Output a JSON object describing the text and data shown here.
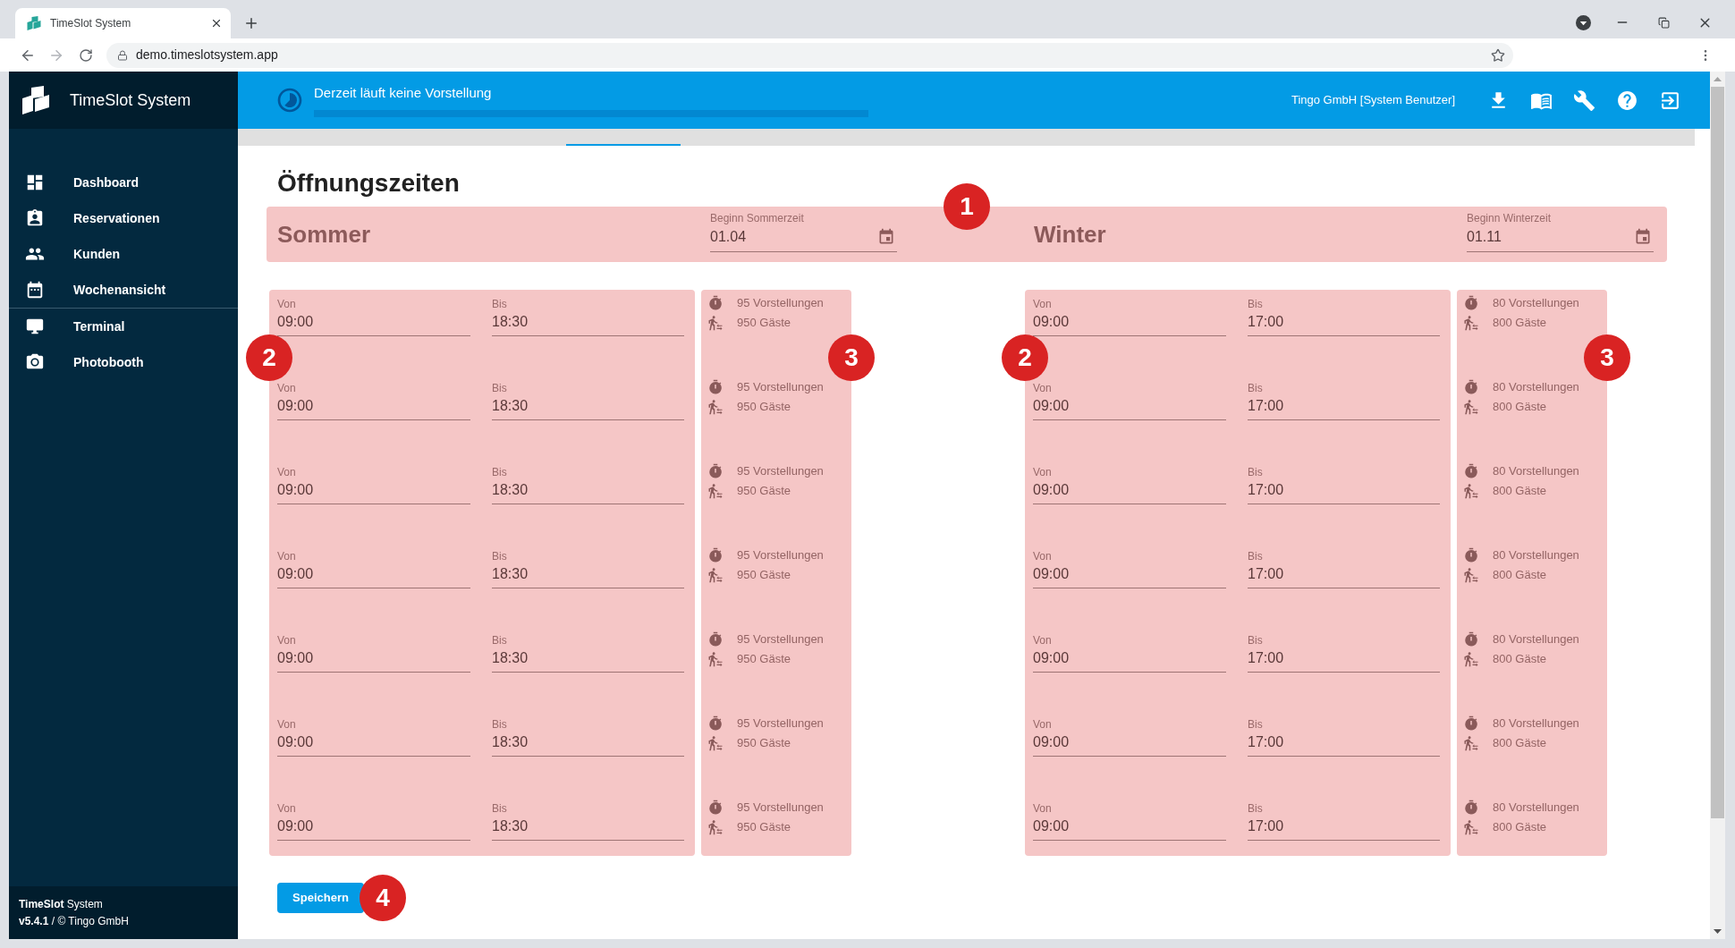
{
  "browser": {
    "tab_title": "TimeSlot System",
    "url": "demo.timeslotsystem.app"
  },
  "sidebar": {
    "brand": "TimeSlot System",
    "groups": [
      {
        "items": [
          {
            "label": "Dashboard",
            "selected": false
          },
          {
            "label": "Reservationen",
            "selected": false
          },
          {
            "label": "Kunden",
            "selected": false
          },
          {
            "label": "Wochenansicht",
            "selected": false
          }
        ]
      },
      {
        "items": [
          {
            "label": "Terminal",
            "selected": false
          },
          {
            "label": "Photobooth",
            "selected": false
          }
        ]
      }
    ],
    "footer": {
      "app": "**TimeSlot** System",
      "version": "**v5.4.1** / © Tingo GmbH"
    }
  },
  "header": {
    "status": "Derzeit läuft keine Vorstellung",
    "progress": {
      "level": 0
    },
    "user": "Tingo GmbH [System Benutzer]"
  },
  "page": {
    "title": "Öffnungszeiten",
    "seasons_marker": "1",
    "seasons": [
      {
        "name": "Sommer",
        "start": {
          "label": "Beginn Sommerzeit",
          "value": "01.04"
        },
        "hours_marker": "2",
        "stats_marker": "3",
        "days": [
          {
            "from": {
              "label": "Von",
              "value": "09:00"
            },
            "to": {
              "label": "Bis",
              "value": "18:30"
            },
            "shows": "95 Vorstellungen",
            "guests": "950 Gäste"
          },
          {
            "from": {
              "label": "Von",
              "value": "09:00"
            },
            "to": {
              "label": "Bis",
              "value": "18:30"
            },
            "shows": "95 Vorstellungen",
            "guests": "950 Gäste"
          },
          {
            "from": {
              "label": "Von",
              "value": "09:00"
            },
            "to": {
              "label": "Bis",
              "value": "18:30"
            },
            "shows": "95 Vorstellungen",
            "guests": "950 Gäste"
          },
          {
            "from": {
              "label": "Von",
              "value": "09:00"
            },
            "to": {
              "label": "Bis",
              "value": "18:30"
            },
            "shows": "95 Vorstellungen",
            "guests": "950 Gäste"
          },
          {
            "from": {
              "label": "Von",
              "value": "09:00"
            },
            "to": {
              "label": "Bis",
              "value": "18:30"
            },
            "shows": "95 Vorstellungen",
            "guests": "950 Gäste"
          },
          {
            "from": {
              "label": "Von",
              "value": "09:00"
            },
            "to": {
              "label": "Bis",
              "value": "18:30"
            },
            "shows": "95 Vorstellungen",
            "guests": "950 Gäste"
          },
          {
            "from": {
              "label": "Von",
              "value": "09:00"
            },
            "to": {
              "label": "Bis",
              "value": "18:30"
            },
            "shows": "95 Vorstellungen",
            "guests": "950 Gäste"
          }
        ]
      },
      {
        "name": "Winter",
        "start": {
          "label": "Beginn Winterzeit",
          "value": "01.11"
        },
        "hours_marker": "2",
        "stats_marker": "3",
        "days": [
          {
            "from": {
              "label": "Von",
              "value": "09:00"
            },
            "to": {
              "label": "Bis",
              "value": "17:00"
            },
            "shows": "80 Vorstellungen",
            "guests": "800 Gäste"
          },
          {
            "from": {
              "label": "Von",
              "value": "09:00"
            },
            "to": {
              "label": "Bis",
              "value": "17:00"
            },
            "shows": "80 Vorstellungen",
            "guests": "800 Gäste"
          },
          {
            "from": {
              "label": "Von",
              "value": "09:00"
            },
            "to": {
              "label": "Bis",
              "value": "17:00"
            },
            "shows": "80 Vorstellungen",
            "guests": "800 Gäste"
          },
          {
            "from": {
              "label": "Von",
              "value": "09:00"
            },
            "to": {
              "label": "Bis",
              "value": "17:00"
            },
            "shows": "80 Vorstellungen",
            "guests": "800 Gäste"
          },
          {
            "from": {
              "label": "Von",
              "value": "09:00"
            },
            "to": {
              "label": "Bis",
              "value": "17:00"
            },
            "shows": "80 Vorstellungen",
            "guests": "800 Gäste"
          },
          {
            "from": {
              "label": "Von",
              "value": "09:00"
            },
            "to": {
              "label": "Bis",
              "value": "17:00"
            },
            "shows": "80 Vorstellungen",
            "guests": "800 Gäste"
          },
          {
            "from": {
              "label": "Von",
              "value": "09:00"
            },
            "to": {
              "label": "Bis",
              "value": "17:00"
            },
            "shows": "80 Vorstellungen",
            "guests": "800 Gäste"
          }
        ]
      }
    ],
    "save": {
      "label": "Speichern",
      "marker": "4"
    }
  }
}
